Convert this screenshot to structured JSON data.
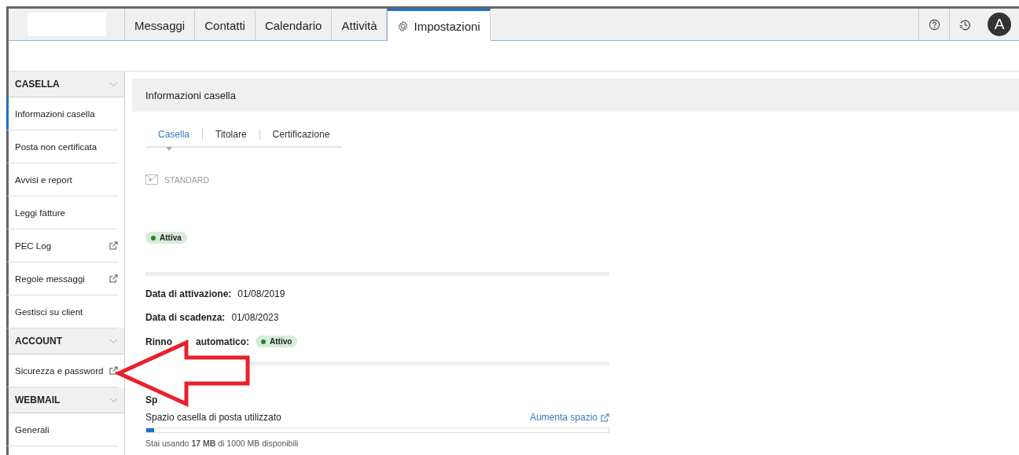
{
  "nav_tabs": [
    {
      "label": "Messaggi",
      "selected": false
    },
    {
      "label": "Contatti",
      "selected": false
    },
    {
      "label": "Calendario",
      "selected": false
    },
    {
      "label": "Attività",
      "selected": false
    },
    {
      "label": "Impostazioni",
      "selected": true,
      "kind": "settings"
    }
  ],
  "avatar": {
    "initial": "A"
  },
  "sidebar": [
    {
      "title": "CASELLA",
      "items": [
        {
          "label": "Informazioni casella",
          "selected": true,
          "external": false
        },
        {
          "label": "Posta non certificata",
          "selected": false,
          "external": false
        },
        {
          "label": "Avvisi e report",
          "selected": false,
          "external": false
        },
        {
          "label": "Leggi fatture",
          "selected": false,
          "external": false
        },
        {
          "label": "PEC Log",
          "selected": false,
          "external": true
        },
        {
          "label": "Regole messaggi",
          "selected": false,
          "external": true
        },
        {
          "label": "Gestisci su client",
          "selected": false,
          "external": false
        }
      ]
    },
    {
      "title": "ACCOUNT",
      "items": [
        {
          "label": "Sicurezza e password",
          "selected": false,
          "external": true
        }
      ]
    },
    {
      "title": "WEBMAIL",
      "items": [
        {
          "label": "Generali",
          "selected": false,
          "external": false
        }
      ]
    }
  ],
  "content": {
    "title": "Informazioni casella",
    "sub_tabs": [
      {
        "label": "Casella",
        "selected": true
      },
      {
        "label": "Titolare",
        "selected": false
      },
      {
        "label": "Certificazione",
        "selected": false
      }
    ],
    "plan": "STANDARD",
    "status": "Attiva",
    "details": [
      {
        "label": "Data di attivazione:",
        "value": "01/08/2019"
      },
      {
        "label": "Data di scadenza:",
        "value": "01/08/2023"
      }
    ],
    "renewal": {
      "label_start": "Rinno",
      "label_end": "automatico:",
      "badge": "Attivo"
    },
    "space": {
      "heading": "Sp",
      "label": "Spazio casella di posta utilizzato",
      "link": "Aumenta spazio",
      "level": 0.017,
      "caption": "Stai usando **17 MB** di 1000 MB disponibili"
    }
  }
}
